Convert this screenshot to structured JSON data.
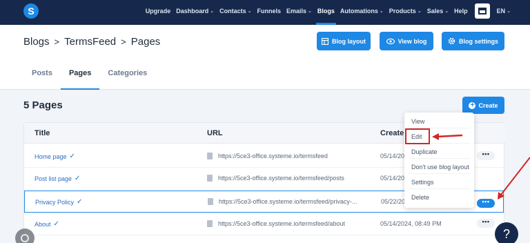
{
  "nav": {
    "logo": "S",
    "items": [
      {
        "label": "Upgrade",
        "chevron": false
      },
      {
        "label": "Dashboard",
        "chevron": true
      },
      {
        "label": "Contacts",
        "chevron": true
      },
      {
        "label": "Funnels",
        "chevron": false
      },
      {
        "label": "Emails",
        "chevron": true
      },
      {
        "label": "Blogs",
        "chevron": false,
        "active": true
      },
      {
        "label": "Automations",
        "chevron": true
      },
      {
        "label": "Products",
        "chevron": true
      },
      {
        "label": "Sales",
        "chevron": true
      },
      {
        "label": "Help",
        "chevron": false
      }
    ],
    "lang": "EN",
    "chevron_glyph": "⌄"
  },
  "breadcrumb": {
    "items": [
      "Blogs",
      "TermsFeed",
      "Pages"
    ],
    "separator": ">"
  },
  "header_buttons": {
    "blog_layout": "Blog layout",
    "view_blog": "View blog",
    "blog_settings": "Blog settings"
  },
  "tabs": [
    "Posts",
    "Pages",
    "Categories"
  ],
  "page_count": "5 Pages",
  "create_label": "Create",
  "table": {
    "headers": [
      "Title",
      "URL",
      "Create"
    ],
    "rows": [
      {
        "title": "Home page",
        "url": "https://5ce3-office.systeme.io/termsfeed",
        "date": "05/14/20"
      },
      {
        "title": "Post list page",
        "url": "https://5ce3-office.systeme.io/termsfeed/posts",
        "date": "05/14/20"
      },
      {
        "title": "Privacy Policy",
        "url": "https://5ce3-office.systeme.io/termsfeed/privacy-...",
        "date": "05/22/20"
      },
      {
        "title": "About",
        "url": "https://5ce3-office.systeme.io/termsfeed/about",
        "date": "05/14/2024, 08:49 PM"
      }
    ],
    "actions_glyph": "•••"
  },
  "menu": [
    "View",
    "Edit",
    "Duplicate",
    "Don't use blog layout",
    "Settings",
    "Delete"
  ],
  "help_label": "?",
  "colors": {
    "nav_bg": "#16294d",
    "accent": "#1e88e5",
    "highlight_red": "#d32626"
  }
}
